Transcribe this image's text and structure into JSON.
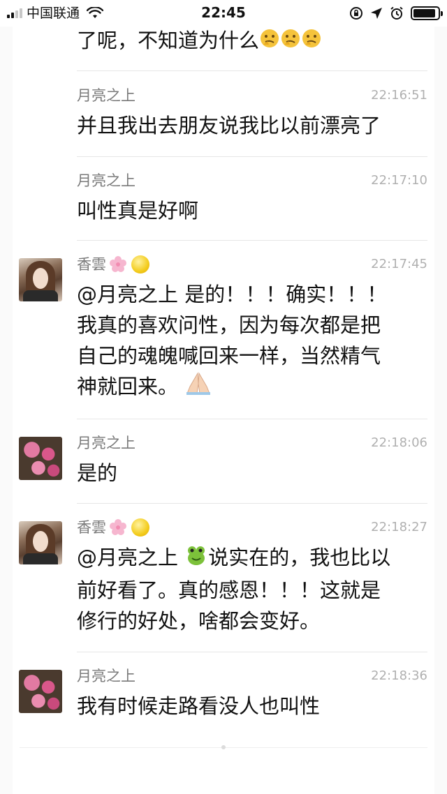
{
  "status_bar": {
    "carrier": "中国联通",
    "time": "22:45",
    "icons": [
      "signal-icon",
      "wifi-icon",
      "lock-rotation-icon",
      "location-arrow-icon",
      "alarm-icon",
      "battery-icon"
    ],
    "signal_bars_active": 2,
    "battery_level": 0.9
  },
  "colors": {
    "text_primary": "#111111",
    "name": "#7a7a7a",
    "timestamp": "#b0b0b0",
    "divider": "#e6e6e6"
  },
  "feed": {
    "first_message_tail": "了呢，不知道为什么",
    "first_message_emoji": [
      "thinking-face-icon",
      "thinking-face-icon",
      "thinking-face-icon"
    ],
    "messages": [
      {
        "name": "月亮之上",
        "time": "22:16:51",
        "text": "并且我出去朋友说我比以前漂亮了",
        "avatar": "none"
      },
      {
        "name": "月亮之上",
        "time": "22:17:10",
        "text": "叫性真是好啊",
        "avatar": "none"
      },
      {
        "name": "香雲",
        "time": "22:17:45",
        "avatar": "woman-photo",
        "name_icons": [
          "cherry-blossom-icon",
          "yellow-circle-icon"
        ],
        "lines": [
          "@月亮之上 是的！！！确实！！！",
          "我真的喜欢问性，因为每次都是把",
          "自己的魂魄喊回来一样，当然精气",
          "神就回来。"
        ],
        "trailing_icon": "folded-hands-icon"
      },
      {
        "name": "月亮之上",
        "time": "22:18:06",
        "text": "是的",
        "avatar": "flower-photo"
      },
      {
        "name": "香雲",
        "time": "22:18:27",
        "avatar": "woman-photo",
        "name_icons": [
          "cherry-blossom-icon",
          "yellow-circle-icon"
        ],
        "lines": [
          "@月亮之上",
          "说实在的，我也比以",
          "前好看了。真的感恩！！！这就是",
          "修行的好处，啥都会变好。"
        ],
        "inline_icon": "frog-emoji-icon"
      },
      {
        "name": "月亮之上",
        "time": "22:18:36",
        "text": "我有时候走路看没人也叫性",
        "avatar": "flower-photo"
      }
    ]
  }
}
